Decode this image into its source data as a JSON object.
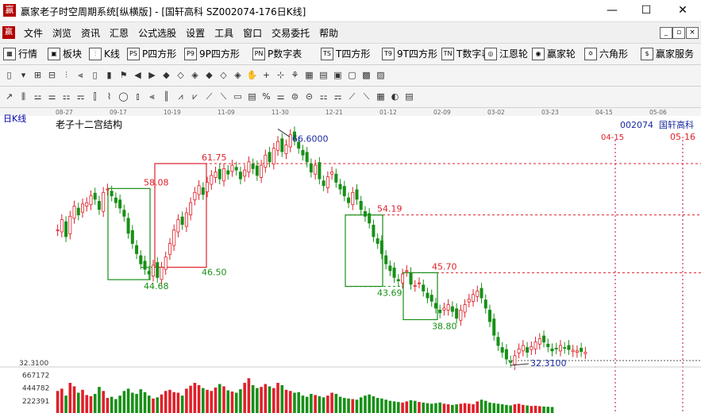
{
  "window": {
    "title": "赢家老子时空周期系统[纵横版] - [国轩高科  SZ002074-176日K线]",
    "app_icon": "赢",
    "minimize": "—",
    "maximize": "☐",
    "close": "✕"
  },
  "menu": {
    "logo": "赢",
    "items": [
      "文件",
      "浏览",
      "资讯",
      "汇恩",
      "公式选股",
      "设置",
      "工具",
      "窗口",
      "交易委托",
      "帮助"
    ],
    "mdi": [
      "_",
      "▫",
      "×"
    ]
  },
  "toolbar1": {
    "items": [
      {
        "icon": "grid-icon",
        "glyph": "▦",
        "label": "行情"
      },
      {
        "icon": "blocks-icon",
        "glyph": "▣",
        "label": "板块"
      },
      {
        "icon": "kline-icon",
        "glyph": "⫶",
        "label": "K线"
      },
      {
        "icon": "ps-icon",
        "glyph": "PS",
        "label": "P四方形"
      },
      {
        "icon": "p9-icon",
        "glyph": "P9",
        "label": "9P四方形"
      },
      {
        "icon": "pn-icon",
        "glyph": "PN",
        "label": "P数字表"
      },
      {
        "icon": "ts-icon",
        "glyph": "TS",
        "label": "T四方形"
      },
      {
        "icon": "t9-icon",
        "glyph": "T9",
        "label": "9T四方形"
      },
      {
        "icon": "tn-icon",
        "glyph": "TN",
        "label": "T数字表"
      },
      {
        "icon": "wheel-icon",
        "glyph": "◎",
        "label": "江恩轮"
      },
      {
        "icon": "ying-wheel-icon",
        "glyph": "◉",
        "label": "赢家轮"
      },
      {
        "icon": "hexagon-icon",
        "glyph": "✡",
        "label": "六角形"
      },
      {
        "icon": "dollar-icon",
        "glyph": "$",
        "label": "赢家服务"
      }
    ]
  },
  "chart_header": {
    "period_label": "日K线",
    "indicator_label": "老子十二宫结构",
    "code": "002074",
    "name": "国轩高科",
    "right_date": "05-16",
    "red_marker": "04-15"
  },
  "date_axis": [
    "08-27",
    "09-17",
    "10-19",
    "11-09",
    "11-30",
    "12-21",
    "01-12",
    "02-09",
    "03-02",
    "03-23",
    "04-15",
    "05-06"
  ],
  "annotations": {
    "high": "66.6000",
    "low": "32.3100",
    "levels": [
      "61.75",
      "58.08",
      "54.19",
      "45.70",
      "46.50",
      "44.68",
      "43.69",
      "38.80"
    ],
    "price_axis_low": "32.3100",
    "volume_ticks": [
      "667172",
      "444782",
      "222391"
    ]
  },
  "chart_data": {
    "type": "candlestick",
    "title": "老子十二宫结构",
    "symbol": "002074 国轩高科",
    "high": 66.6,
    "low": 32.31,
    "support_resistance": [
      61.75,
      58.08,
      54.19,
      45.7,
      46.5,
      44.68,
      43.69,
      38.8
    ],
    "closes_approx": [
      52.0,
      53.5,
      51.0,
      54.0,
      55.5,
      54.2,
      55.8,
      56.0,
      57.0,
      56.5,
      55.0,
      57.5,
      58.0,
      57.0,
      56.0,
      55.2,
      54.0,
      51.5,
      50.0,
      48.5,
      47.0,
      46.2,
      45.5,
      46.8,
      45.0,
      46.5,
      48.0,
      50.0,
      52.0,
      53.5,
      52.8,
      54.5,
      56.0,
      57.5,
      58.5,
      57.2,
      59.0,
      60.0,
      60.5,
      59.5,
      61.0,
      60.2,
      61.5,
      60.8,
      59.5,
      60.8,
      62.0,
      61.0,
      60.0,
      61.5,
      63.0,
      62.0,
      64.0,
      65.0,
      63.5,
      64.5,
      66.0,
      65.2,
      64.0,
      63.0,
      62.0,
      60.5,
      61.5,
      59.5,
      58.5,
      59.8,
      60.5,
      59.0,
      58.0,
      57.0,
      56.0,
      57.5,
      56.5,
      55.0,
      54.0,
      53.0,
      51.0,
      50.0,
      48.5,
      47.0,
      46.0,
      45.0,
      44.5,
      45.5,
      46.0,
      44.0,
      43.8,
      44.2,
      43.0,
      42.0,
      41.5,
      40.5,
      39.8,
      40.5,
      41.0,
      40.0,
      39.0,
      40.2,
      41.0,
      41.8,
      42.5,
      43.0,
      42.0,
      40.5,
      38.5,
      36.5,
      35.0,
      34.0,
      33.0,
      32.5,
      33.5,
      34.5,
      35.0,
      34.0,
      34.8,
      35.5,
      36.0,
      35.5,
      34.8,
      34.2,
      34.5,
      35.0,
      34.6,
      34.4,
      34.3,
      34.2,
      34.1,
      34.0
    ],
    "volumes_approx": [
      380000,
      420000,
      300000,
      520000,
      460000,
      350000,
      400000,
      310000,
      290000,
      330000,
      450000,
      380000,
      260000,
      280000,
      240000,
      300000,
      380000,
      420000,
      350000,
      330000,
      410000,
      360000,
      300000,
      250000,
      270000,
      320000,
      380000,
      400000,
      360000,
      350000,
      300000,
      420000,
      470000,
      520000,
      480000,
      430000,
      400000,
      380000,
      440000,
      500000,
      460000,
      390000,
      370000,
      350000,
      410000,
      520000,
      600000,
      480000,
      430000,
      450000,
      500000,
      460000,
      430000,
      520000,
      480000,
      400000,
      380000,
      350000,
      360000,
      300000,
      280000,
      330000,
      310000,
      290000,
      270000,
      300000,
      350000,
      330000,
      280000,
      260000,
      250000,
      240000,
      230000,
      270000,
      300000,
      320000,
      290000,
      260000,
      250000,
      230000,
      210000,
      200000,
      190000,
      180000,
      200000,
      220000,
      210000,
      190000,
      180000,
      170000,
      160000,
      170000,
      180000,
      160000,
      150000,
      140000,
      150000,
      160000,
      170000,
      160000,
      150000,
      200000,
      230000,
      210000,
      180000,
      170000,
      160000,
      150000,
      140000,
      130000,
      150000,
      160000,
      140000,
      130000,
      120000,
      125000,
      118000,
      112000,
      108000,
      104000
    ],
    "ylim": [
      32.31,
      67.0
    ],
    "volume_ticks": [
      667172,
      444782,
      222391
    ]
  },
  "colors": {
    "up": "#e0202a",
    "down": "#179017",
    "level_red": "#e0202a",
    "level_green": "#179017",
    "label_blue": "#1a2aa0",
    "marker_red": "#e0202a"
  }
}
